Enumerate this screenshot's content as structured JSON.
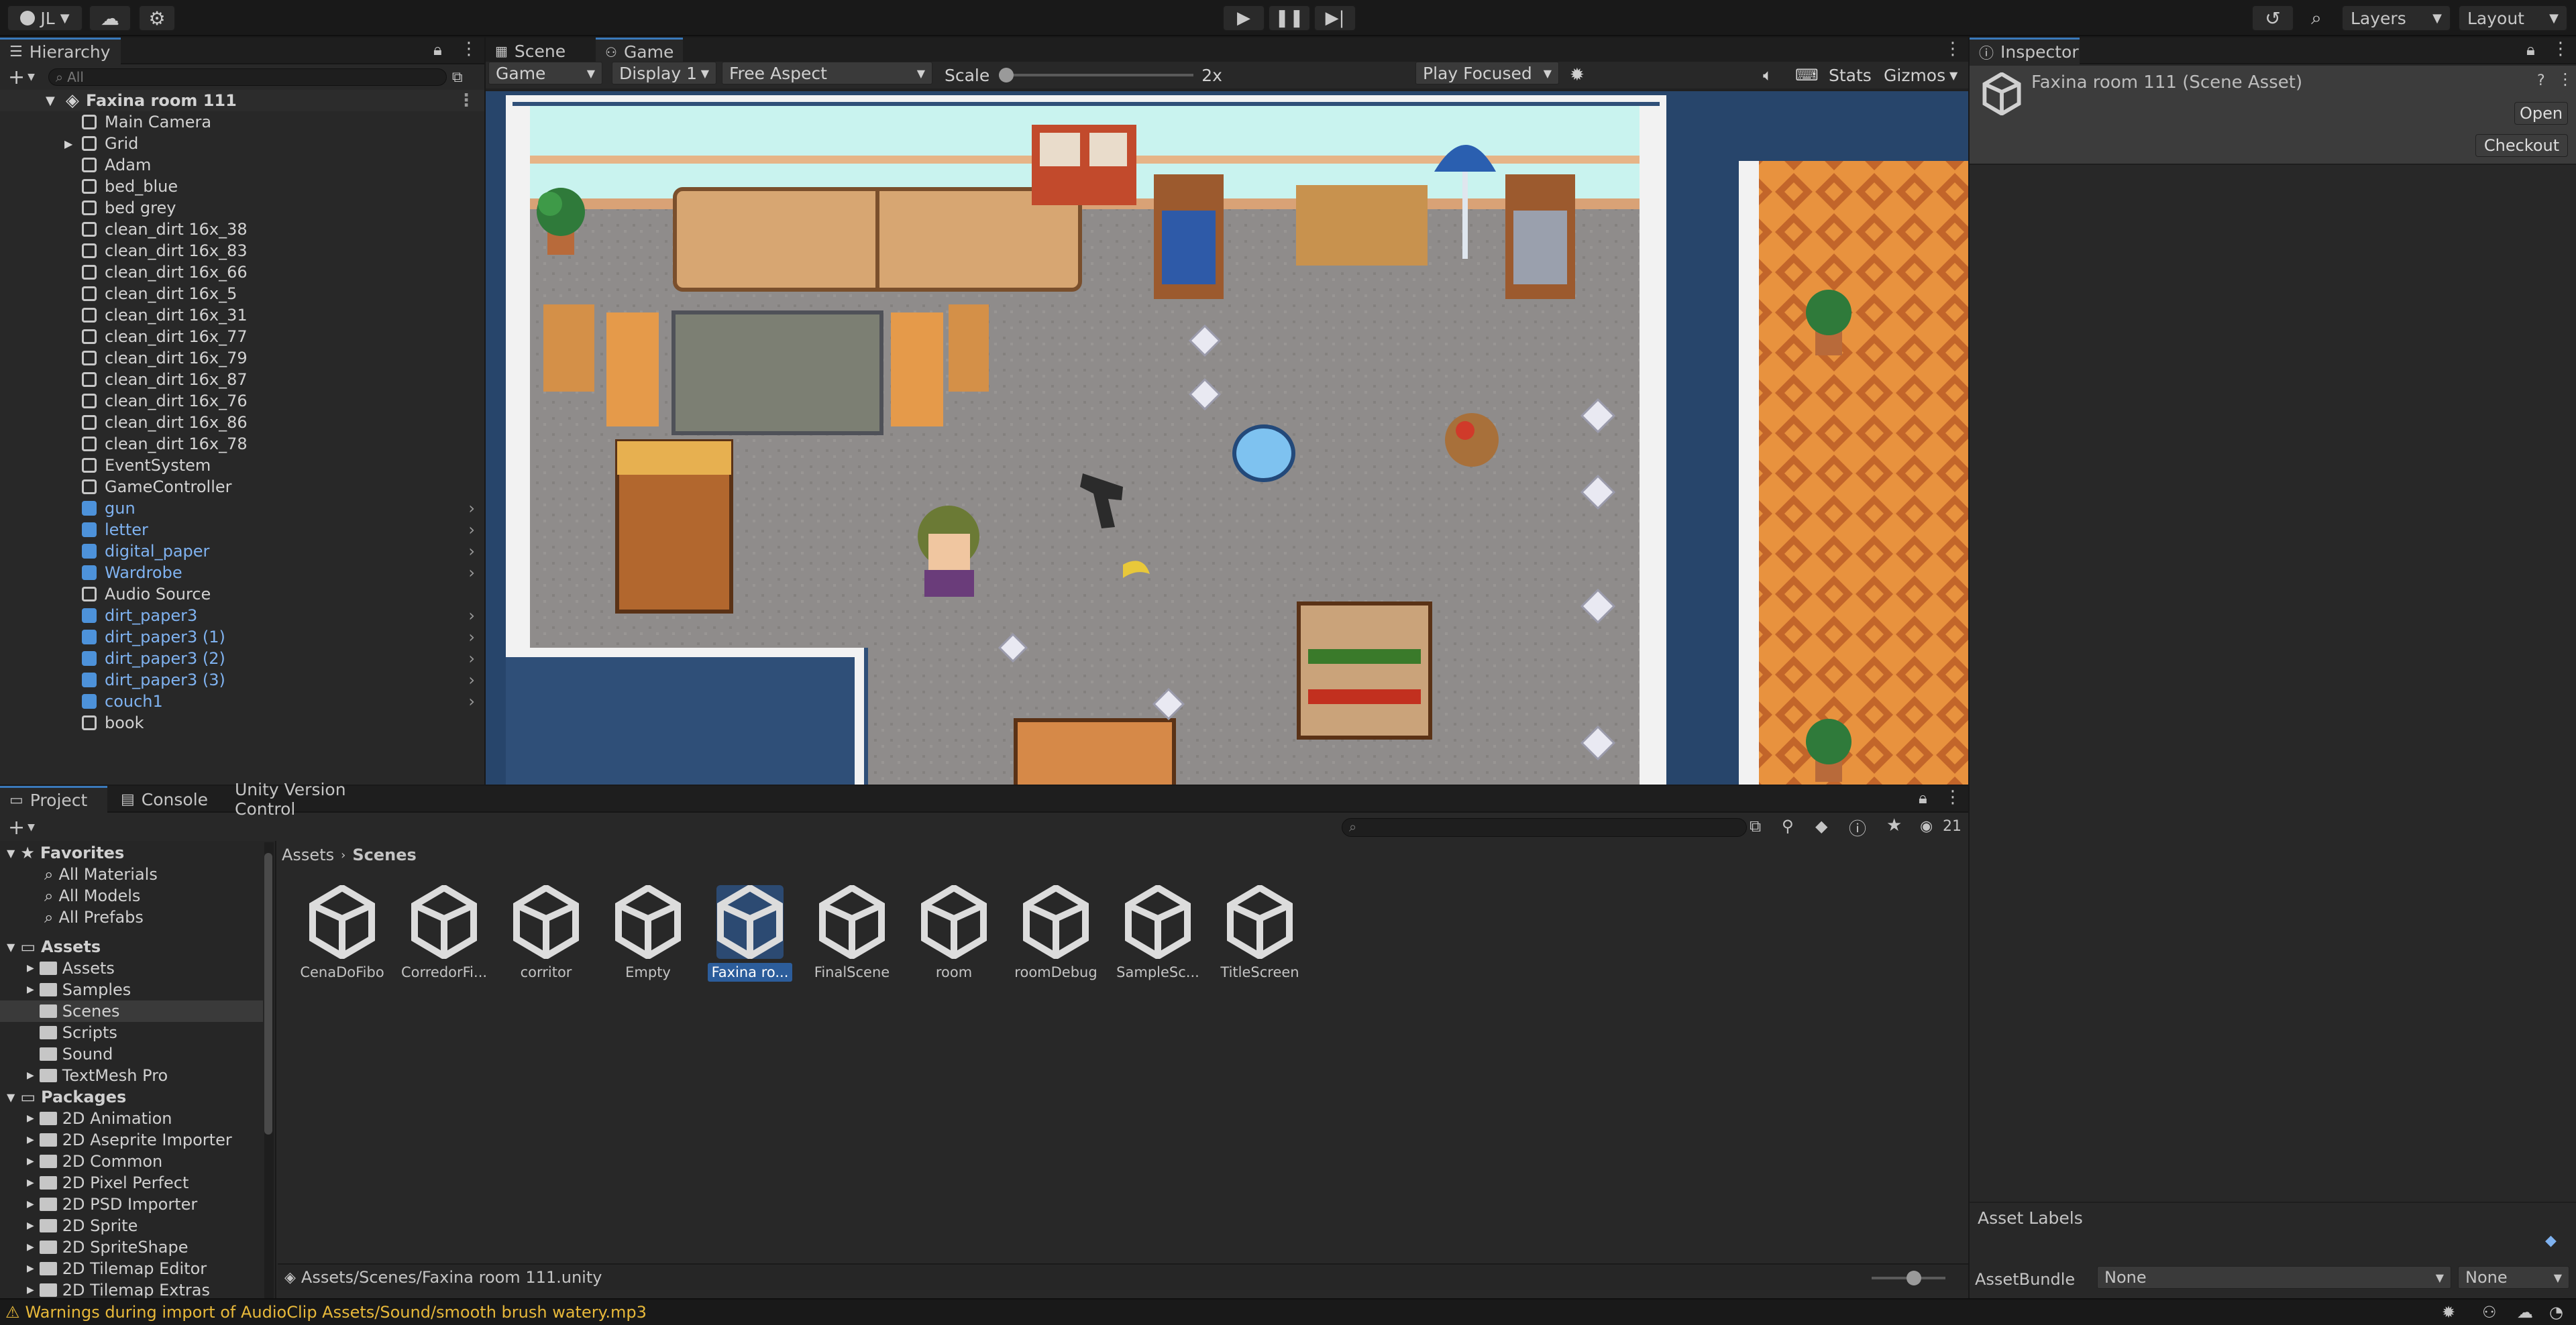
{
  "toolbar": {
    "account": "JL",
    "layers": "Layers",
    "layout": "Layout"
  },
  "hierarchy": {
    "tab": "Hierarchy",
    "search_placeholder": "All",
    "scene": "Faxina room 111",
    "items": [
      {
        "label": "Main Camera",
        "prefab": false,
        "chev": false,
        "fold": false
      },
      {
        "label": "Grid",
        "prefab": false,
        "chev": false,
        "fold": true
      },
      {
        "label": "Adam",
        "prefab": false,
        "chev": false,
        "fold": false
      },
      {
        "label": "bed_blue",
        "prefab": false,
        "chev": false,
        "fold": false
      },
      {
        "label": "bed grey",
        "prefab": false,
        "chev": false,
        "fold": false
      },
      {
        "label": "clean_dirt 16x_38",
        "prefab": false,
        "chev": false,
        "fold": false
      },
      {
        "label": "clean_dirt 16x_83",
        "prefab": false,
        "chev": false,
        "fold": false
      },
      {
        "label": "clean_dirt 16x_66",
        "prefab": false,
        "chev": false,
        "fold": false
      },
      {
        "label": "clean_dirt 16x_5",
        "prefab": false,
        "chev": false,
        "fold": false
      },
      {
        "label": "clean_dirt 16x_31",
        "prefab": false,
        "chev": false,
        "fold": false
      },
      {
        "label": "clean_dirt 16x_77",
        "prefab": false,
        "chev": false,
        "fold": false
      },
      {
        "label": "clean_dirt 16x_79",
        "prefab": false,
        "chev": false,
        "fold": false
      },
      {
        "label": "clean_dirt 16x_87",
        "prefab": false,
        "chev": false,
        "fold": false
      },
      {
        "label": "clean_dirt 16x_76",
        "prefab": false,
        "chev": false,
        "fold": false
      },
      {
        "label": "clean_dirt 16x_86",
        "prefab": false,
        "chev": false,
        "fold": false
      },
      {
        "label": "clean_dirt 16x_78",
        "prefab": false,
        "chev": false,
        "fold": false
      },
      {
        "label": "EventSystem",
        "prefab": false,
        "chev": false,
        "fold": false
      },
      {
        "label": "GameController",
        "prefab": false,
        "chev": false,
        "fold": false
      },
      {
        "label": "gun",
        "prefab": true,
        "chev": true,
        "fold": false
      },
      {
        "label": "letter",
        "prefab": true,
        "chev": true,
        "fold": false
      },
      {
        "label": "digital_paper",
        "prefab": true,
        "chev": true,
        "fold": false
      },
      {
        "label": "Wardrobe",
        "prefab": true,
        "chev": true,
        "fold": false
      },
      {
        "label": "Audio Source",
        "prefab": false,
        "chev": false,
        "fold": false
      },
      {
        "label": "dirt_paper3",
        "prefab": true,
        "chev": true,
        "fold": false
      },
      {
        "label": "dirt_paper3 (1)",
        "prefab": true,
        "chev": true,
        "fold": false
      },
      {
        "label": "dirt_paper3 (2)",
        "prefab": true,
        "chev": true,
        "fold": false
      },
      {
        "label": "dirt_paper3 (3)",
        "prefab": true,
        "chev": true,
        "fold": false
      },
      {
        "label": "couch1",
        "prefab": true,
        "chev": true,
        "fold": false
      },
      {
        "label": "book",
        "prefab": false,
        "chev": false,
        "fold": false
      }
    ]
  },
  "game": {
    "tabs": [
      "Scene",
      "Game"
    ],
    "mode": "Game",
    "display": "Display 1",
    "aspect": "Free Aspect",
    "scale_label": "Scale",
    "scale_value": "2x",
    "scale_fraction": 0.0,
    "play_focus": "Play Focused",
    "stats": "Stats",
    "gizmos": "Gizmos"
  },
  "inspector": {
    "tab": "Inspector",
    "title": "Faxina room 111 (Scene Asset)",
    "open": "Open",
    "checkout": "Checkout",
    "asset_labels": "Asset Labels",
    "assetbundle_label": "AssetBundle",
    "assetbundle_value": "None",
    "variant_value": "None"
  },
  "project": {
    "tabs": [
      "Project",
      "Console",
      "Unity Version Control"
    ],
    "hidden_count": "21",
    "breadcrumb": [
      "Assets",
      "Scenes"
    ],
    "favorites_label": "Favorites",
    "favorites": [
      "All Materials",
      "All Models",
      "All Prefabs"
    ],
    "assets_label": "Assets",
    "asset_folders": [
      "Assets",
      "Samples",
      "Scenes",
      "Scripts",
      "Sound",
      "TextMesh Pro"
    ],
    "packages_label": "Packages",
    "packages": [
      "2D Animation",
      "2D Aseprite Importer",
      "2D Common",
      "2D Pixel Perfect",
      "2D PSD Importer",
      "2D Sprite",
      "2D SpriteShape",
      "2D Tilemap Editor",
      "2D Tilemap Extras"
    ],
    "scenes": [
      "CenaDoFibo",
      "CorredorFi...",
      "corritor",
      "Empty",
      "Faxina ro...",
      "FinalScene",
      "room",
      "roomDebug",
      "SampleSc...",
      "TitleScreen"
    ],
    "selected_index": 4,
    "path": "Assets/Scenes/Faxina room 111.unity"
  },
  "status": {
    "warning": "Warnings during import of AudioClip Assets/Sound/smooth brush watery.mp3"
  },
  "colors": {
    "accent": "#3a79bb",
    "prefab": "#7fb2f0",
    "warning": "#e8b93a",
    "floor": "#8e8c8a",
    "carpet": "#e08c3c"
  }
}
